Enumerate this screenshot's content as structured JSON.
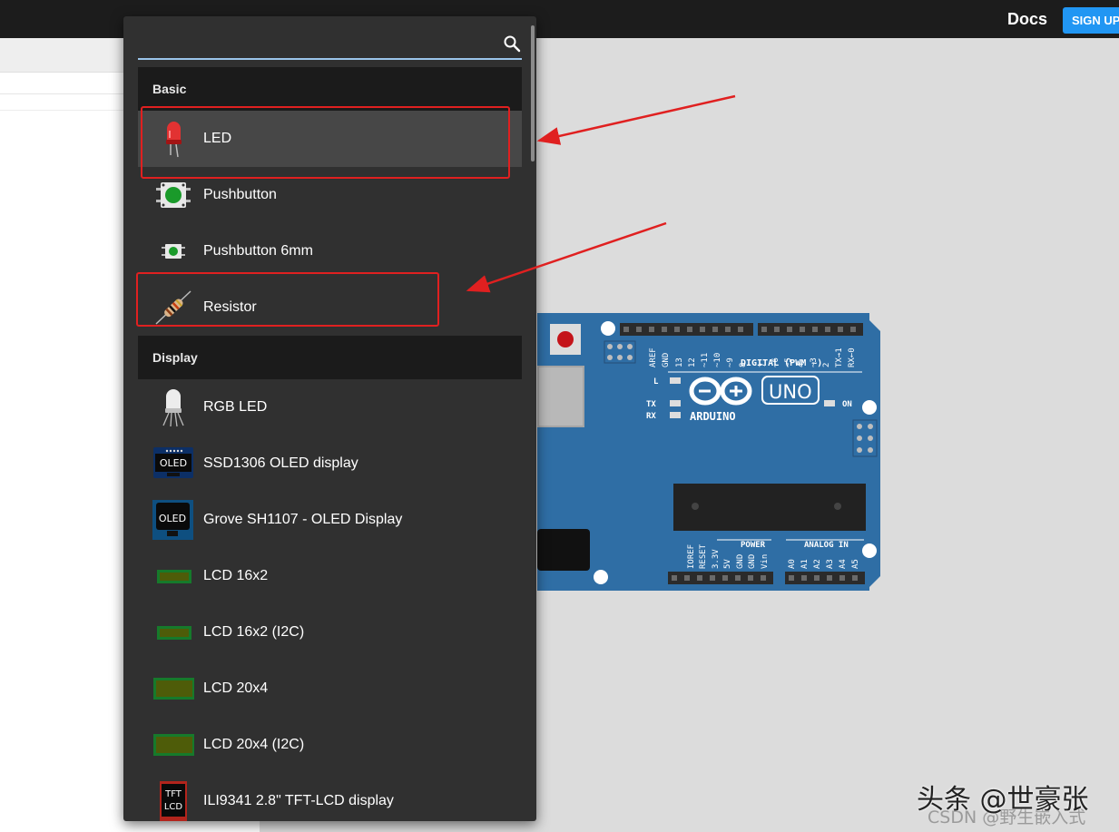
{
  "header": {
    "docs_label": "Docs",
    "signup_label": "SIGN UP"
  },
  "dropdown": {
    "search": {
      "value": "",
      "placeholder": ""
    },
    "sections": [
      {
        "title": "Basic",
        "items": [
          {
            "label": "LED",
            "icon": "led-icon",
            "highlighted": true
          },
          {
            "label": "Pushbutton",
            "icon": "pushbutton-icon"
          },
          {
            "label": "Pushbutton 6mm",
            "icon": "pushbutton-6mm-icon"
          },
          {
            "label": "Resistor",
            "icon": "resistor-icon"
          }
        ]
      },
      {
        "title": "Display",
        "items": [
          {
            "label": "RGB LED",
            "icon": "rgb-led-icon"
          },
          {
            "label": "SSD1306 OLED display",
            "icon": "oled-icon",
            "icon_text": "OLED"
          },
          {
            "label": "Grove SH1107 - OLED Display",
            "icon": "grove-oled-icon",
            "icon_text": "OLED"
          },
          {
            "label": "LCD 16x2",
            "icon": "lcd-icon"
          },
          {
            "label": "LCD 16x2 (I2C)",
            "icon": "lcd-icon"
          },
          {
            "label": "LCD 20x4",
            "icon": "lcd-icon"
          },
          {
            "label": "LCD 20x4 (I2C)",
            "icon": "lcd-icon"
          },
          {
            "label": "ILI9341 2.8\" TFT-LCD display",
            "icon": "tft-lcd-icon",
            "icon_text": "TFT LCD"
          }
        ]
      }
    ]
  },
  "board": {
    "logo_text": "ARDUINO",
    "model": "UNO",
    "digital_label": "DIGITAL (PWM ~)",
    "power_label": "POWER",
    "analog_label": "ANALOG IN",
    "on_label": "ON",
    "l_label": "L",
    "tx_label": "TX",
    "rx_label": "RX",
    "digital_pins": [
      "AREF",
      "GND",
      "13",
      "12",
      "~11",
      "~10",
      "~9",
      "8",
      "7",
      "~6",
      "~5",
      "4",
      "~3",
      "2",
      "TX→1",
      "RX←0"
    ],
    "power_pins": [
      "IOREF",
      "RESET",
      "3.3V",
      "5V",
      "GND",
      "GND",
      "Vin"
    ],
    "analog_pins": [
      "A0",
      "A1",
      "A2",
      "A3",
      "A4",
      "A5"
    ]
  },
  "watermark": {
    "main": "头条 @世豪张",
    "sub": "CSDN @野生嵌入式"
  },
  "colors": {
    "highlight_box": "#e02020",
    "board": "#2f6ea5",
    "accent": "#2196f3"
  }
}
